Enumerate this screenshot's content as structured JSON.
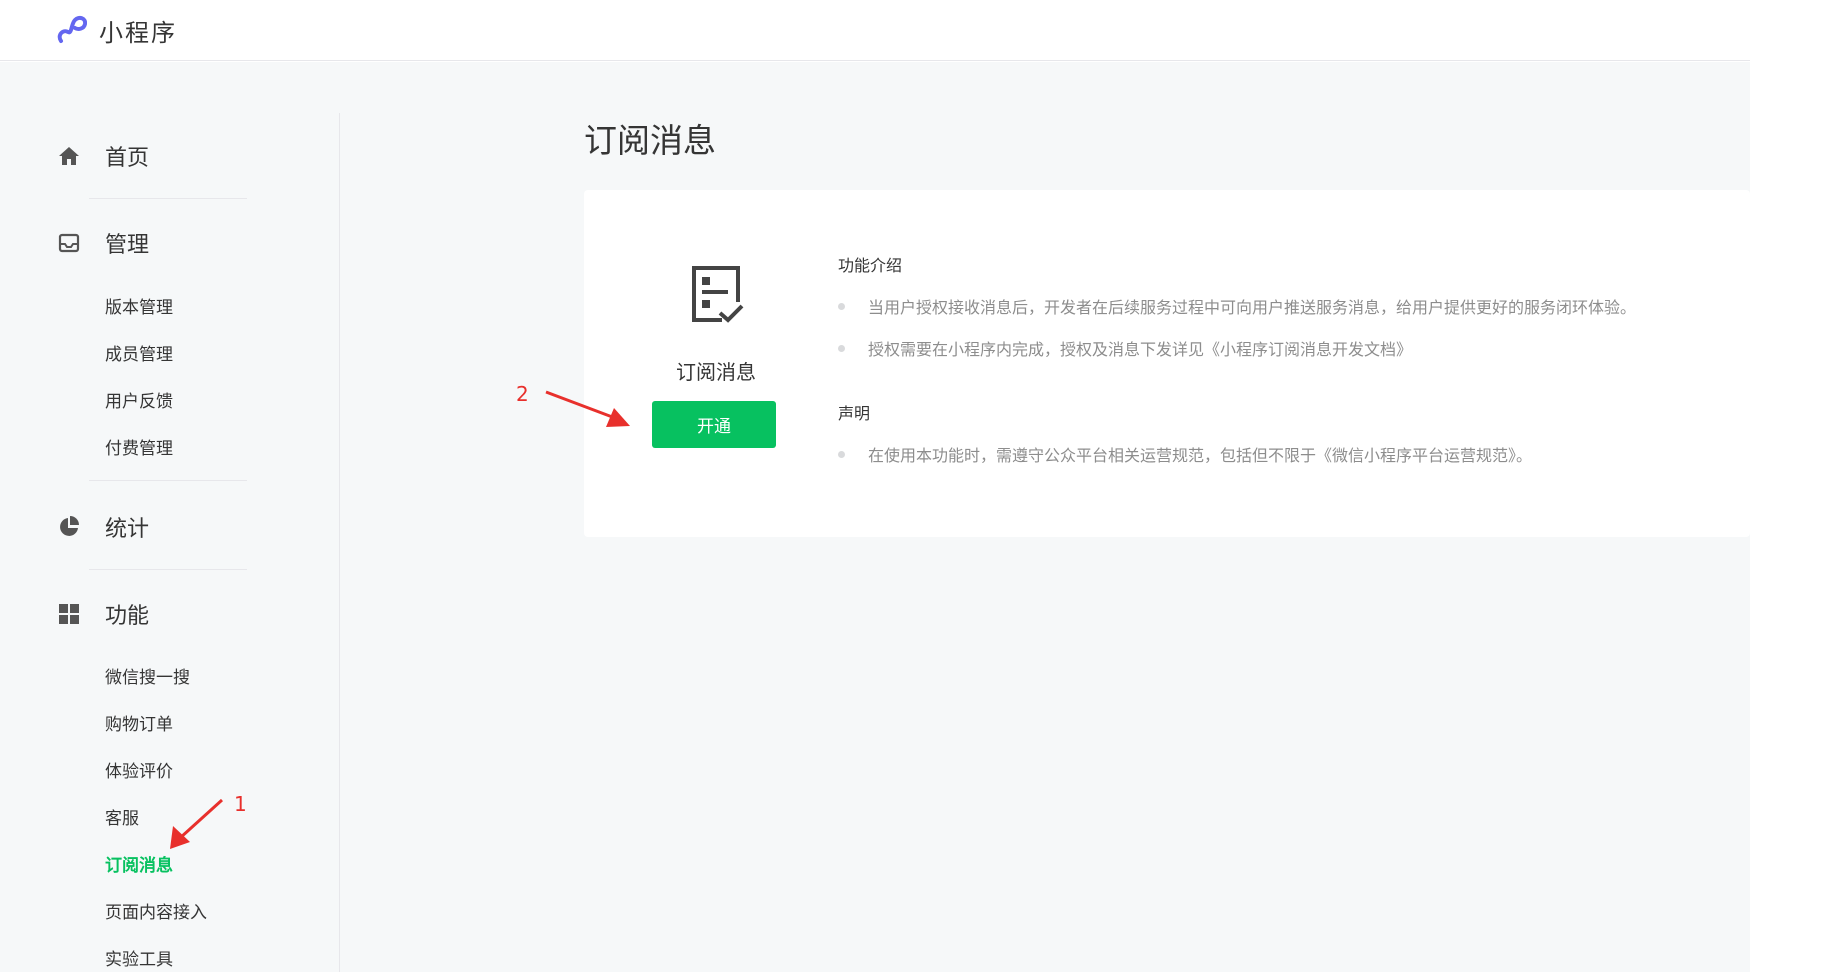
{
  "header": {
    "app_name": "小程序",
    "logo": "miniprogram-logo-icon",
    "logo_color": "#6467f0"
  },
  "sidebar": {
    "groups": [
      {
        "label": "首页",
        "icon": "home-icon",
        "items": []
      },
      {
        "label": "管理",
        "icon": "inbox-icon",
        "items": [
          "版本管理",
          "成员管理",
          "用户反馈",
          "付费管理"
        ]
      },
      {
        "label": "统计",
        "icon": "pie-chart-icon",
        "items": []
      },
      {
        "label": "功能",
        "icon": "grid-icon",
        "items": [
          "微信搜一搜",
          "购物订单",
          "体验评价",
          "客服",
          "订阅消息",
          "页面内容接入",
          "实验工具"
        ]
      }
    ],
    "active_item": "订阅消息",
    "active_color": "#07c160"
  },
  "main": {
    "title": "订阅消息",
    "card": {
      "icon": "subscribe-message-icon",
      "name": "订阅消息",
      "button_label": "开通",
      "button_color": "#07c160",
      "sections": [
        {
          "title": "功能介绍",
          "bullets": [
            "当用户授权接收消息后，开发者在后续服务过程中可向用户推送服务消息，给用户提供更好的服务闭环体验。",
            "授权需要在小程序内完成，授权及消息下发详见《小程序订阅消息开发文档》"
          ]
        },
        {
          "title": "声明",
          "bullets": [
            "在使用本功能时，需遵守公众平台相关运营规范，包括但不限于《微信小程序平台运营规范》。"
          ]
        }
      ]
    }
  },
  "annotations": {
    "label_1": "1",
    "label_2": "2",
    "color": "#e8302c"
  }
}
